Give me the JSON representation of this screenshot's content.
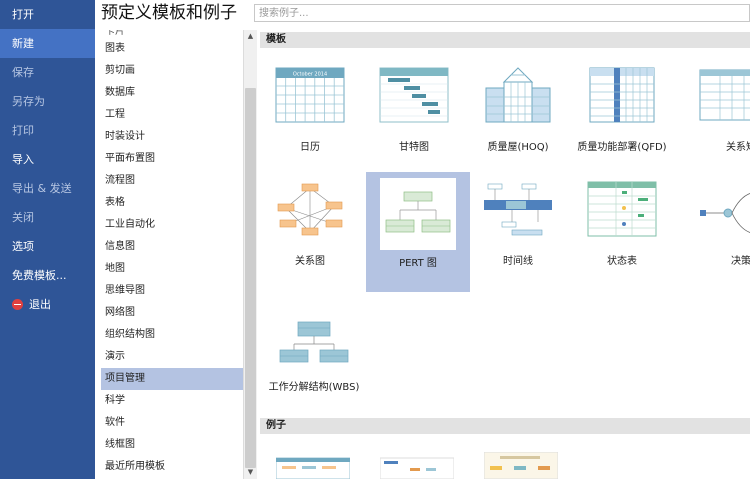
{
  "nav": {
    "items": [
      {
        "label": "打开",
        "state": "normal"
      },
      {
        "label": "新建",
        "state": "active"
      },
      {
        "label": "保存",
        "state": "dim"
      },
      {
        "label": "另存为",
        "state": "dim"
      },
      {
        "label": "打印",
        "state": "dim"
      },
      {
        "label": "导入",
        "state": "normal"
      },
      {
        "label": "导出 & 发送",
        "state": "dim"
      },
      {
        "label": "关闭",
        "state": "dim"
      },
      {
        "label": "选项",
        "state": "normal"
      },
      {
        "label": "免费模板...",
        "state": "normal"
      },
      {
        "label": "退出",
        "state": "normal"
      }
    ]
  },
  "header": {
    "title": "预定义模板和例子",
    "search_placeholder": "搜索例子..."
  },
  "categories": {
    "partial_top": "卡片",
    "items": [
      "图表",
      "剪切画",
      "数据库",
      "工程",
      "时装设计",
      "平面布置图",
      "流程图",
      "表格",
      "工业自动化",
      "信息图",
      "地图",
      "思维导图",
      "网络图",
      "组织结构图",
      "演示",
      "项目管理",
      "科学",
      "软件",
      "线框图",
      "最近所用模板"
    ],
    "selected": "项目管理"
  },
  "sections": {
    "templates": "模板",
    "examples": "例子"
  },
  "templates": [
    {
      "label": "日历",
      "icon": "calendar-thumb",
      "calendar_header": "October 2014"
    },
    {
      "label": "甘特图",
      "icon": "gantt-thumb"
    },
    {
      "label": "质量屋(HOQ)",
      "icon": "hoq-thumb"
    },
    {
      "label": "质量功能部署(QFD)",
      "icon": "qfd-thumb"
    },
    {
      "label": "关系矩阵",
      "icon": "relation-matrix-thumb"
    },
    {
      "label": "关系图",
      "icon": "relation-diagram-thumb"
    },
    {
      "label": "PERT 图",
      "icon": "pert-thumb",
      "selected": true
    },
    {
      "label": "时间线",
      "icon": "timeline-thumb"
    },
    {
      "label": "状态表",
      "icon": "status-table-thumb"
    },
    {
      "label": "决策树",
      "icon": "decision-tree-thumb"
    },
    {
      "label": "工作分解结构(WBS)",
      "icon": "wbs-thumb"
    }
  ],
  "colors": {
    "nav_bg": "#2f5597",
    "nav_active": "#4472c4",
    "selection": "#b4c3e2",
    "accent_teal": "#7fb8c4",
    "accent_blue": "#4f81bd"
  }
}
